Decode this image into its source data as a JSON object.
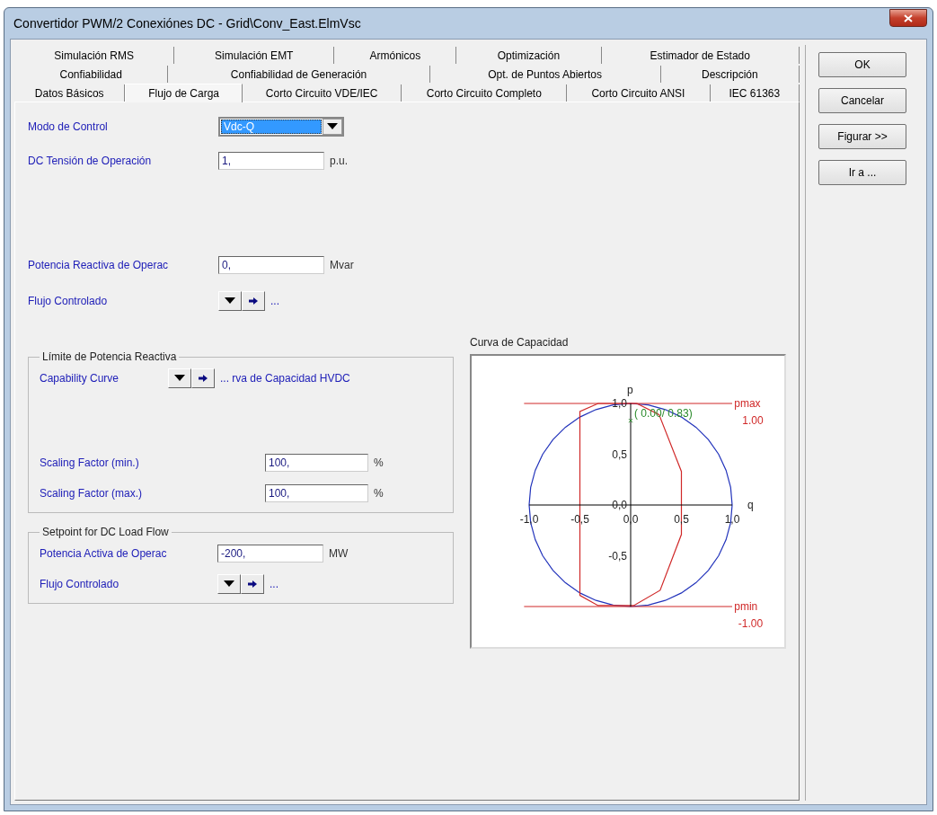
{
  "window": {
    "title": "Convertidor PWM/2 Conexiónes DC - Grid\\Conv_East.ElmVsc"
  },
  "tab_rows": [
    {
      "tabs": [
        {
          "label": "Simulación RMS",
          "selected": false
        },
        {
          "label": "Simulación EMT",
          "selected": false
        },
        {
          "label": "Armónicos",
          "selected": false
        },
        {
          "label": "Optimización",
          "selected": false
        },
        {
          "label": "Estimador de Estado",
          "selected": false
        }
      ]
    },
    {
      "tabs": [
        {
          "label": "Confiabilidad",
          "selected": false
        },
        {
          "label": "Confiabilidad de Generación",
          "selected": false
        },
        {
          "label": "Opt. de Puntos Abiertos",
          "selected": false
        },
        {
          "label": "Descripción",
          "selected": false
        }
      ]
    },
    {
      "tabs": [
        {
          "label": "Datos Básicos",
          "selected": false
        },
        {
          "label": "Flujo de Carga",
          "selected": true
        },
        {
          "label": "Corto Circuito VDE/IEC",
          "selected": false
        },
        {
          "label": "Corto Circuito Completo",
          "selected": false
        },
        {
          "label": "Corto Circuito ANSI",
          "selected": false
        },
        {
          "label": "IEC 61363",
          "selected": false
        }
      ]
    }
  ],
  "buttons": [
    "OK",
    "Cancelar",
    "Figurar >>",
    "Ir a ..."
  ],
  "control": [
    {
      "kind": "dropdown",
      "label": "Modo de Control",
      "value": "Vdc-Q",
      "highlighted": true
    },
    {
      "kind": "field",
      "label": "DC Tensión de Operación",
      "value": "1,",
      "unit": "p.u."
    }
  ],
  "operation": [
    {
      "kind": "field",
      "label": "Potencia Reactiva de Operac",
      "value": "0,",
      "unit": "Mvar"
    },
    {
      "kind": "selector",
      "label": "Flujo Controlado",
      "text": "..."
    }
  ],
  "reactive_limit": {
    "title": "Límite de Potencia Reactiva",
    "selector": {
      "kind": "selector",
      "label": "Capability Curve",
      "text": "... rva de Capacidad HVDC"
    },
    "scaling": [
      {
        "kind": "field",
        "label": "Scaling Factor (min.)",
        "value": "100,",
        "unit": "%"
      },
      {
        "kind": "field",
        "label": "Scaling Factor (max.)",
        "value": "100,",
        "unit": "%"
      }
    ]
  },
  "dc_setpoint": {
    "title": "Setpoint for DC Load Flow",
    "rows": [
      {
        "kind": "field",
        "label": "Potencia Activa de Operac",
        "value": "-200,",
        "unit": "MW"
      },
      {
        "kind": "selector",
        "label": "Flujo Controlado",
        "text": "..."
      }
    ]
  },
  "capability_chart": {
    "title": "Curva de Capacidad",
    "x_axis_label": "q",
    "y_axis_label": "p",
    "x_tick_labels": [
      "-1,0",
      "-0,5",
      "0,0",
      "0,5",
      "1,0"
    ],
    "y_tick_labels": [
      "1,0",
      "0,5",
      "0,0",
      "-0,5"
    ],
    "operating_point": "( 0.00/ 0.83)",
    "upper_limit": {
      "name": "pmax",
      "value": "1.00"
    },
    "lower_limit": {
      "name": "pmin",
      "value": "-1.00"
    }
  }
}
